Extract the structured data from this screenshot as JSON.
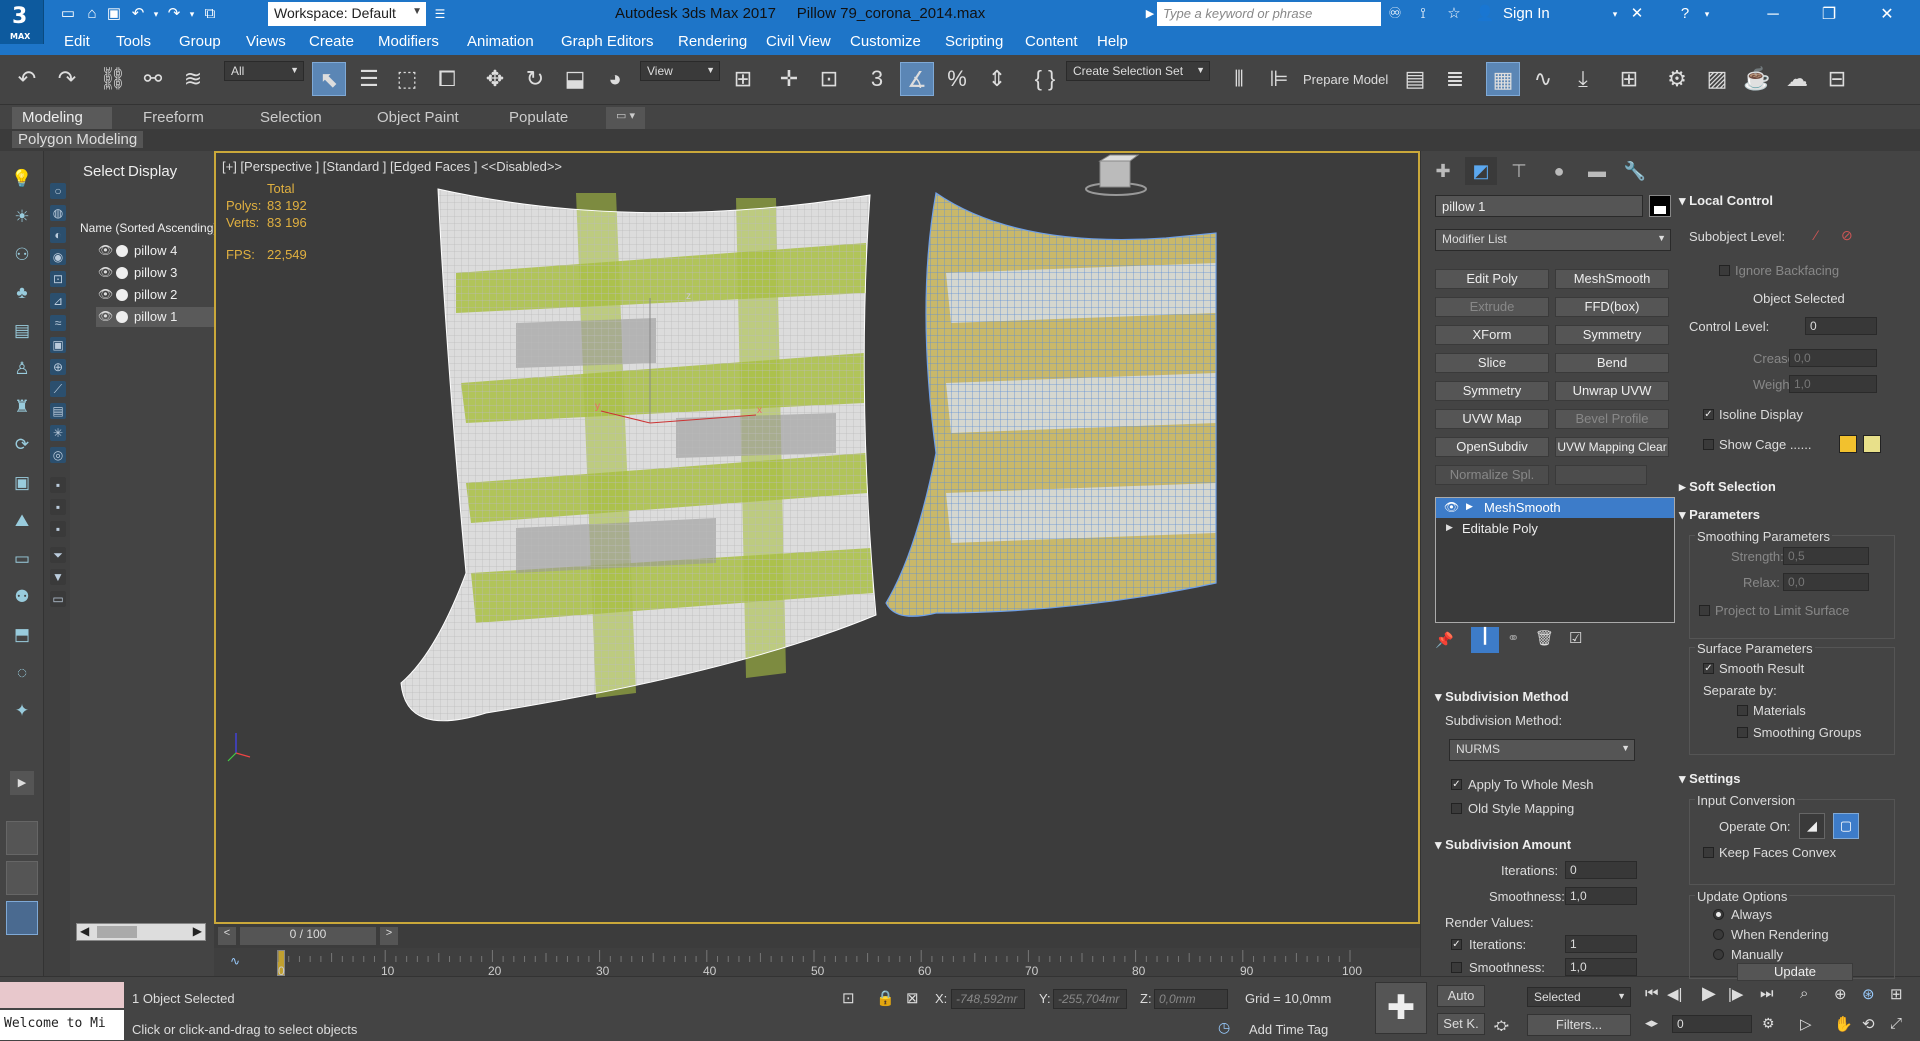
{
  "titlebar": {
    "logo_text": "3",
    "logo_sub": "MAX",
    "workspace": "Workspace: Default",
    "app_name": "Autodesk 3ds Max 2017",
    "file_name": "Pillow 79_corona_2014.max",
    "search_placeholder": "Type a keyword or phrase",
    "signin": "Sign In"
  },
  "menu": [
    "Edit",
    "Tools",
    "Group",
    "Views",
    "Create",
    "Modifiers",
    "Animation",
    "Graph Editors",
    "Rendering",
    "Civil View",
    "Customize",
    "Scripting",
    "Content",
    "Help"
  ],
  "toolbar": {
    "filter_value": "All",
    "refcoord_value": "View",
    "selection_set_value": "Create Selection Set",
    "prepare_model_label": "Prepare Model"
  },
  "ribbon": {
    "tabs": [
      "Modeling",
      "Freeform",
      "Selection",
      "Object Paint",
      "Populate"
    ],
    "sub_label": "Polygon Modeling"
  },
  "scene_explorer": {
    "tabs": [
      "Select",
      "Display"
    ],
    "column_header": "Name (Sorted Ascending)",
    "items": [
      "pillow 4",
      "pillow 3",
      "pillow 2",
      "pillow 1"
    ],
    "selected": "pillow 1"
  },
  "viewport": {
    "label": "[+] [Perspective ] [Standard ] [Edged Faces ]  <<Disabled>>",
    "stats_header": "Total",
    "polys_label": "Polys:",
    "polys_value": "83 192",
    "verts_label": "Verts:",
    "verts_value": "83 196",
    "fps_label": "FPS:",
    "fps_value": "22,549",
    "axis_x": "x",
    "axis_y": "y",
    "axis_z": "z"
  },
  "timeline": {
    "frame_label": "0 / 100",
    "ticks": [
      "0",
      "10",
      "20",
      "30",
      "40",
      "50",
      "60",
      "70",
      "80",
      "90",
      "100"
    ]
  },
  "status": {
    "welcome": "Welcome to Mi",
    "selected_count": "1 Object Selected",
    "prompt": "Click or click-and-drag to select objects",
    "x_label": "X:",
    "x_value": "-748,592mr",
    "y_label": "Y:",
    "y_value": "-255,704mr",
    "z_label": "Z:",
    "z_value": "0,0mm",
    "grid": "Grid = 10,0mm",
    "add_time_tag": "Add Time Tag",
    "auto_label": "Auto",
    "setk_label": "Set K.",
    "selected_dd": "Selected",
    "filters_label": "Filters...",
    "frame_value": "0"
  },
  "command_panel": {
    "object_name": "pillow 1",
    "modifier_list": "Modifier List",
    "modifier_buttons": [
      {
        "label": "Edit Poly",
        "enabled": true
      },
      {
        "label": "MeshSmooth",
        "enabled": true
      },
      {
        "label": "Extrude",
        "enabled": false
      },
      {
        "label": "FFD(box)",
        "enabled": true
      },
      {
        "label": "XForm",
        "enabled": true
      },
      {
        "label": "Symmetry",
        "enabled": true
      },
      {
        "label": "Slice",
        "enabled": true
      },
      {
        "label": "Bend",
        "enabled": true
      },
      {
        "label": "Symmetry",
        "enabled": true
      },
      {
        "label": "Unwrap UVW",
        "enabled": true
      },
      {
        "label": "UVW Map",
        "enabled": true
      },
      {
        "label": "Bevel Profile",
        "enabled": false
      },
      {
        "label": "OpenSubdiv",
        "enabled": true
      },
      {
        "label": "UVW Mapping Clear",
        "enabled": true
      },
      {
        "label": "Normalize Spl.",
        "enabled": false
      },
      {
        "label": "",
        "enabled": false
      }
    ],
    "stack": [
      "MeshSmooth",
      "Editable Poly"
    ],
    "subdivision_method_title": "Subdivision Method",
    "subdivision_method_label": "Subdivision Method:",
    "subdivision_method_value": "NURMS",
    "apply_whole_mesh": "Apply To Whole Mesh",
    "old_style_mapping": "Old Style Mapping",
    "subdivision_amount_title": "Subdivision Amount",
    "iterations_label": "Iterations:",
    "iterations_value": "0",
    "smoothness_label": "Smoothness:",
    "smoothness_value": "1,0",
    "render_values_label": "Render Values:",
    "render_iterations_label": "Iterations:",
    "render_iterations_value": "1",
    "render_smoothness_label": "Smoothness:",
    "render_smoothness_value": "1,0"
  },
  "right_panel": {
    "local_control_title": "Local Control",
    "subobject_level": "Subobject Level:",
    "ignore_backfacing": "Ignore Backfacing",
    "object_selected": "Object Selected",
    "control_level_label": "Control Level:",
    "control_level_value": "0",
    "crease_label": "Crease:",
    "crease_value": "0,0",
    "weight_label": "Weight:",
    "weight_value": "1,0",
    "isoline_display": "Isoline Display",
    "show_cage": "Show Cage ......",
    "soft_selection_title": "Soft Selection",
    "parameters_title": "Parameters",
    "smoothing_params": "Smoothing Parameters",
    "strength_label": "Strength:",
    "strength_value": "0,5",
    "relax_label": "Relax:",
    "relax_value": "0,0",
    "project_limit": "Project to Limit Surface",
    "surface_params": "Surface Parameters",
    "smooth_result": "Smooth Result",
    "separate_by": "Separate by:",
    "materials": "Materials",
    "smoothing_groups": "Smoothing Groups",
    "settings_title": "Settings",
    "input_conversion": "Input Conversion",
    "operate_on": "Operate On:",
    "keep_faces_convex": "Keep Faces Convex",
    "update_options": "Update Options",
    "always": "Always",
    "when_rendering": "When Rendering",
    "manually": "Manually",
    "update_button": "Update",
    "cage_color1": "#f2c12e",
    "cage_color2": "#e8e08a"
  },
  "colors": {
    "titlebar": "#1e75c8",
    "viewport_border": "#caa83a",
    "stat_text": "#e0b040",
    "active_tool": "#5b86b5",
    "selection_highlight": "#3d7cc9"
  }
}
